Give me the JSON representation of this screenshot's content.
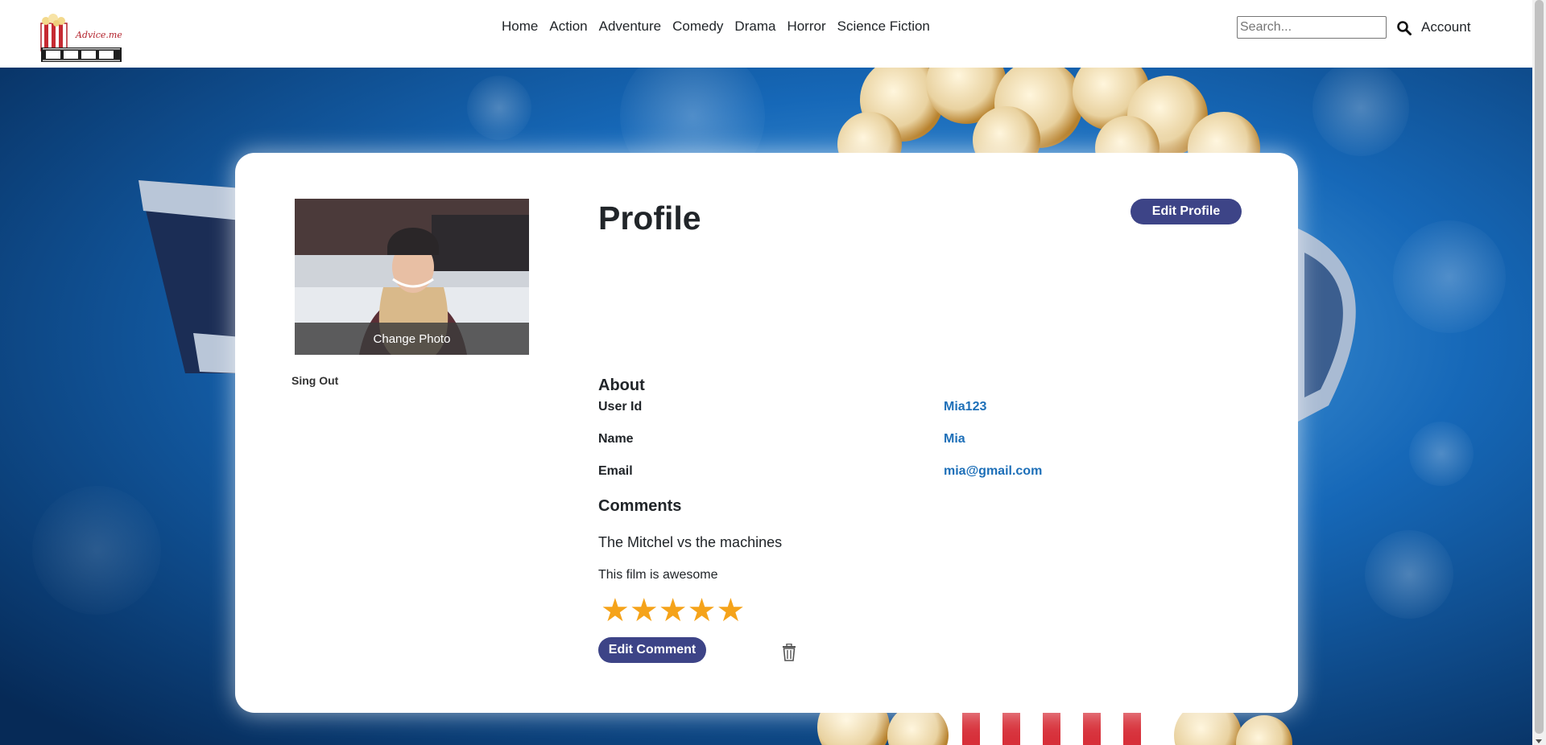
{
  "navbar": {
    "logo_text": "Advice.me",
    "links": [
      {
        "label": "Home"
      },
      {
        "label": "Action"
      },
      {
        "label": "Adventure"
      },
      {
        "label": "Comedy"
      },
      {
        "label": "Drama"
      },
      {
        "label": "Horror"
      },
      {
        "label": "Science Fiction"
      }
    ],
    "search": {
      "placeholder": "Search...",
      "value": "",
      "icon": "search-icon"
    },
    "account_label": "Account"
  },
  "sidebar": {
    "photo_alt": "User profile photo",
    "change_photo_label": "Change Photo",
    "sign_out_label": "Sing Out"
  },
  "profile": {
    "title": "Profile",
    "edit_button_label": "Edit Profile",
    "about": {
      "title": "About",
      "fields": [
        {
          "label": "User Id",
          "value": "Mia123"
        },
        {
          "label": "Name",
          "value": "Mia"
        },
        {
          "label": "Email",
          "value": "mia@gmail.com"
        }
      ]
    },
    "comments": {
      "title": "Comments",
      "items": [
        {
          "movie": "The Mitchel vs the machines",
          "text": "This film is awesome",
          "rating": 5,
          "rating_max": 5,
          "edit_label": "Edit Comment",
          "delete_icon": "trash-icon"
        }
      ]
    }
  },
  "colors": {
    "accent_button": "#3d4487",
    "link_value": "#1d6fb8",
    "star": "#f5a31a",
    "background_blue": "#0a3f7a"
  }
}
